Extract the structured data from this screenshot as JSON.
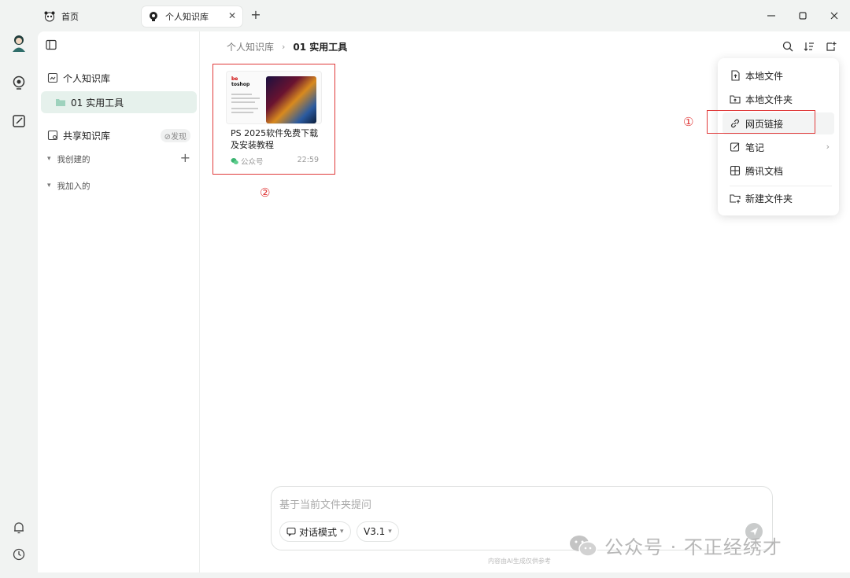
{
  "tabs": [
    {
      "label": "首页",
      "icon": "panda-icon"
    },
    {
      "label": "个人知识库",
      "icon": "bulb-icon",
      "active": true
    }
  ],
  "sidebar": {
    "personal_kb": "个人知识库",
    "folder": "01 实用工具",
    "shared_kb": "共享知识库",
    "discover": "⊘发现",
    "created_by_me": "我创建的",
    "joined": "我加入的"
  },
  "breadcrumb": {
    "root": "个人知识库",
    "current": "01 实用工具"
  },
  "card": {
    "thumb_line1": "be",
    "thumb_line2": "toshop",
    "title": "PS 2025软件免费下载及安装教程",
    "source": "公众号",
    "time": "22:59"
  },
  "menu": {
    "items": [
      {
        "label": "本地文件",
        "icon": "file-upload-icon"
      },
      {
        "label": "本地文件夹",
        "icon": "folder-upload-icon"
      },
      {
        "label": "网页链接",
        "icon": "link-icon"
      },
      {
        "label": "笔记",
        "icon": "note-edit-icon"
      },
      {
        "label": "腾讯文档",
        "icon": "tencent-doc-icon"
      },
      {
        "label": "新建文件夹",
        "icon": "new-folder-icon"
      }
    ]
  },
  "annotations": {
    "marker1": "①",
    "marker2": "②",
    "accent": "#e03a3a"
  },
  "chat": {
    "placeholder": "基于当前文件夹提问",
    "mode": "对话模式",
    "version": "V3.1",
    "disclaimer": "内容由AI生成仅供参考"
  },
  "watermark": {
    "text": "公众号 · 不正经绣才"
  }
}
